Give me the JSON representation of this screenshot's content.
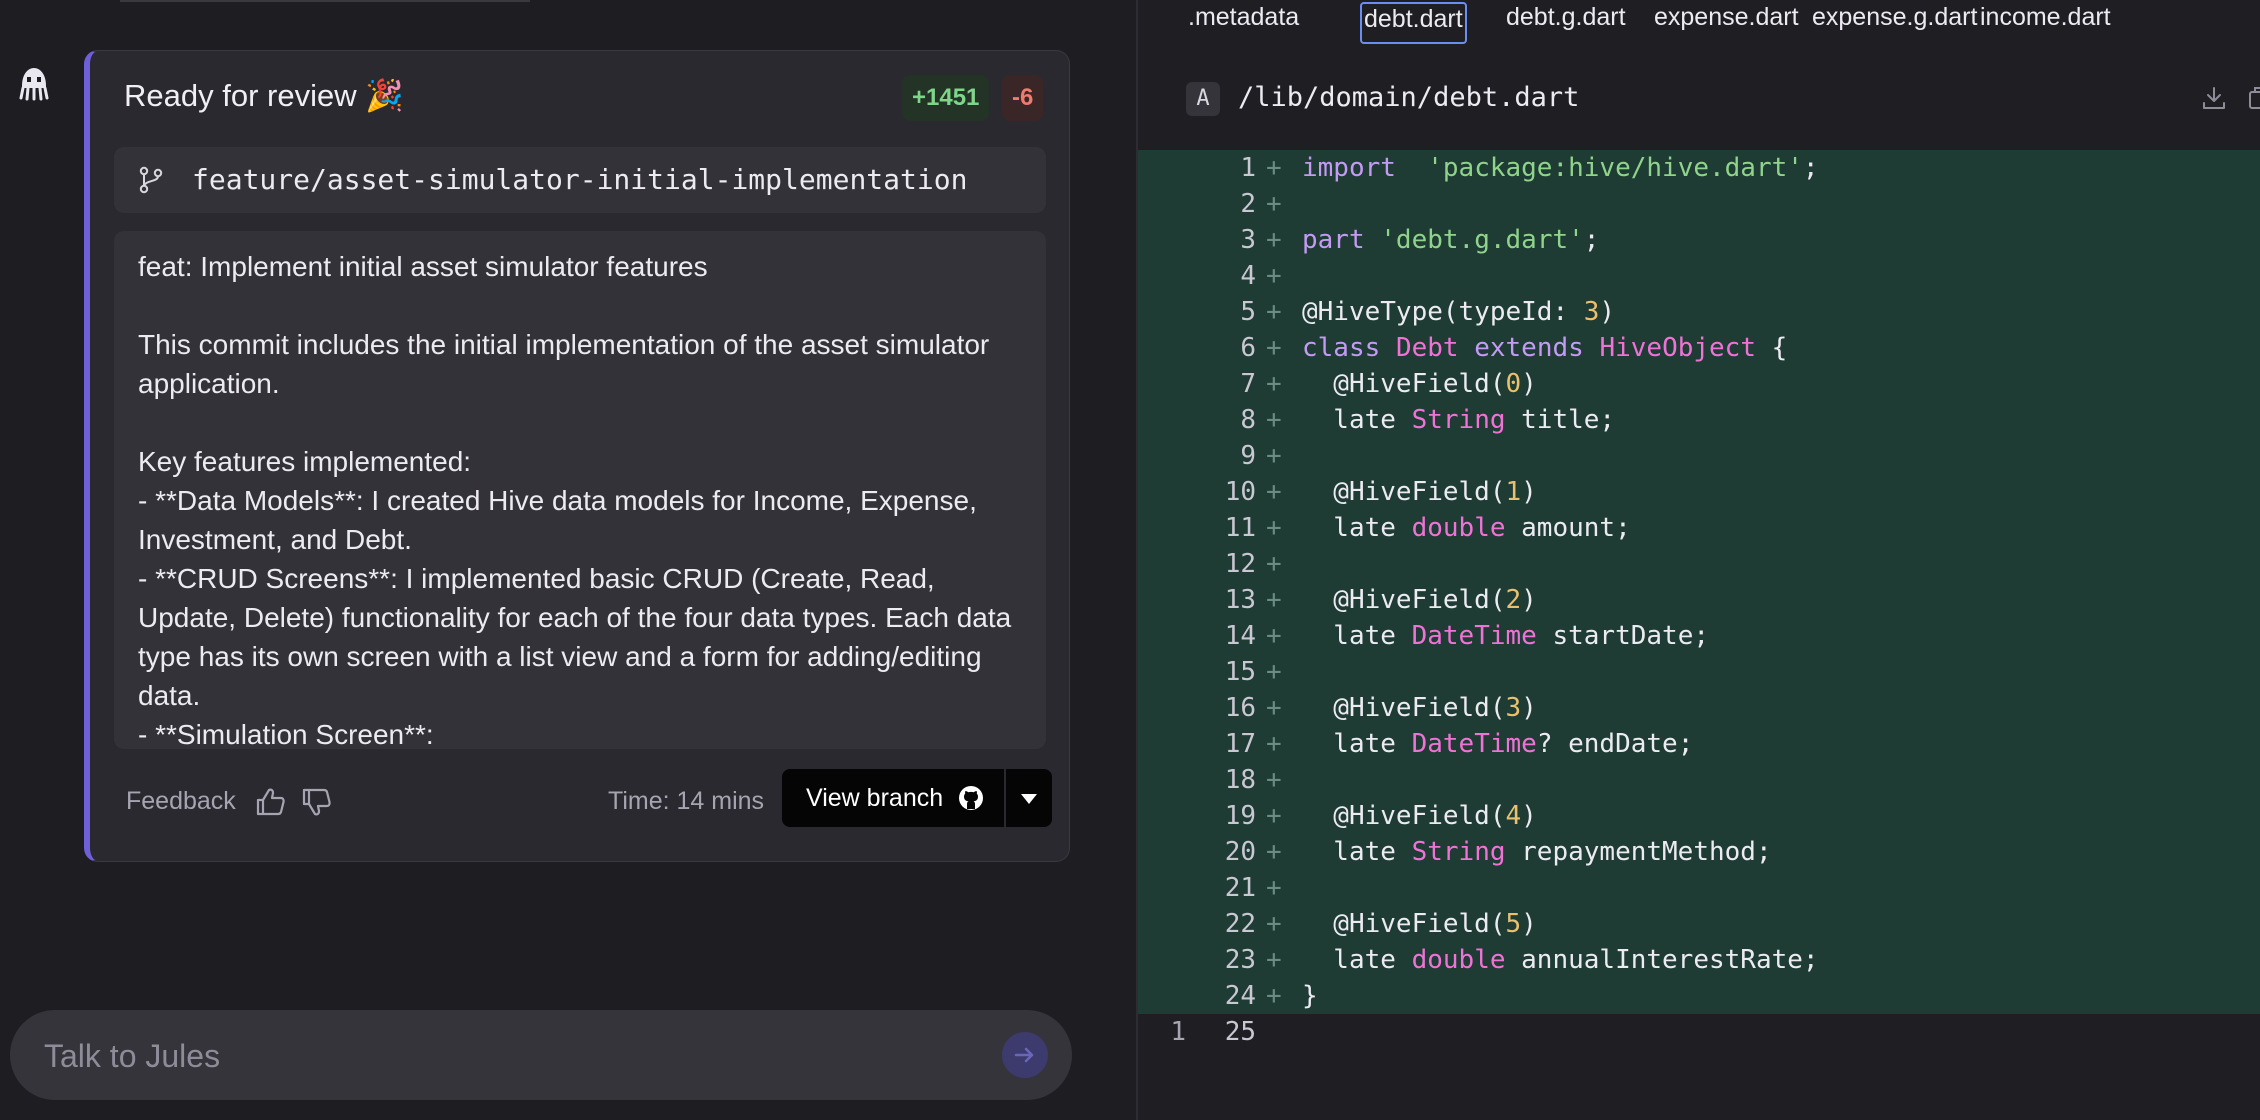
{
  "card": {
    "title": "Ready for review 🎉",
    "additions": "+1451",
    "deletions": "-6",
    "branch": "feature/asset-simulator-initial-implementation",
    "commit_lines": [
      "feat: Implement initial asset simulator features",
      "",
      "This commit includes the initial implementation of the asset simulator application.",
      "",
      "Key features implemented:",
      "-   **Data Models**: I created Hive data models for Income, Expense, Investment, and Debt.",
      "-   **CRUD Screens**: I implemented basic CRUD (Create, Read, Update, Delete) functionality for each of the four data types. Each data type has its own screen with a list view and a form for adding/editing data.",
      "-   **Simulation Screen**:"
    ],
    "feedback_label": "Feedback",
    "time_label": "Time: 14 mins",
    "view_branch_label": "View branch"
  },
  "chat": {
    "placeholder": "Talk to Jules"
  },
  "file_tabs": [
    {
      "label": ".metadata",
      "active": false
    },
    {
      "label": "debt.dart",
      "active": true
    },
    {
      "label": "debt.g.dart",
      "active": false
    },
    {
      "label": "expense.dart",
      "active": false
    },
    {
      "label": "expense.g.dart",
      "active": false
    },
    {
      "label": "income.dart",
      "active": false
    }
  ],
  "file": {
    "type_badge": "A",
    "path": "/lib/domain/debt.dart"
  },
  "code_lines": [
    {
      "old": "",
      "new": "1",
      "added": true,
      "tokens": [
        [
          "kw",
          "import"
        ],
        [
          "",
          "  "
        ],
        [
          "str",
          "'package:hive/hive.dart'"
        ],
        [
          "",
          ";"
        ]
      ]
    },
    {
      "old": "",
      "new": "2",
      "added": true,
      "tokens": []
    },
    {
      "old": "",
      "new": "3",
      "added": true,
      "tokens": [
        [
          "kw",
          "part"
        ],
        [
          "",
          " "
        ],
        [
          "str",
          "'debt.g.dart'"
        ],
        [
          "",
          ";"
        ]
      ]
    },
    {
      "old": "",
      "new": "4",
      "added": true,
      "tokens": []
    },
    {
      "old": "",
      "new": "5",
      "added": true,
      "tokens": [
        [
          "",
          "@HiveType(typeId: "
        ],
        [
          "num",
          "3"
        ],
        [
          "",
          ")"
        ]
      ]
    },
    {
      "old": "",
      "new": "6",
      "added": true,
      "tokens": [
        [
          "kw",
          "class"
        ],
        [
          "",
          " "
        ],
        [
          "type",
          "Debt"
        ],
        [
          "",
          " "
        ],
        [
          "kw",
          "extends"
        ],
        [
          "",
          " "
        ],
        [
          "type",
          "HiveObject"
        ],
        [
          "",
          " {"
        ]
      ]
    },
    {
      "old": "",
      "new": "7",
      "added": true,
      "tokens": [
        [
          "",
          "  @HiveField("
        ],
        [
          "num",
          "0"
        ],
        [
          "",
          ")"
        ]
      ]
    },
    {
      "old": "",
      "new": "8",
      "added": true,
      "tokens": [
        [
          "",
          "  late "
        ],
        [
          "type",
          "String"
        ],
        [
          "",
          " title;"
        ]
      ]
    },
    {
      "old": "",
      "new": "9",
      "added": true,
      "tokens": []
    },
    {
      "old": "",
      "new": "10",
      "added": true,
      "tokens": [
        [
          "",
          "  @HiveField("
        ],
        [
          "num",
          "1"
        ],
        [
          "",
          ")"
        ]
      ]
    },
    {
      "old": "",
      "new": "11",
      "added": true,
      "tokens": [
        [
          "",
          "  late "
        ],
        [
          "type",
          "double"
        ],
        [
          "",
          " amount;"
        ]
      ]
    },
    {
      "old": "",
      "new": "12",
      "added": true,
      "tokens": []
    },
    {
      "old": "",
      "new": "13",
      "added": true,
      "tokens": [
        [
          "",
          "  @HiveField("
        ],
        [
          "num",
          "2"
        ],
        [
          "",
          ")"
        ]
      ]
    },
    {
      "old": "",
      "new": "14",
      "added": true,
      "tokens": [
        [
          "",
          "  late "
        ],
        [
          "type",
          "DateTime"
        ],
        [
          "",
          " startDate;"
        ]
      ]
    },
    {
      "old": "",
      "new": "15",
      "added": true,
      "tokens": []
    },
    {
      "old": "",
      "new": "16",
      "added": true,
      "tokens": [
        [
          "",
          "  @HiveField("
        ],
        [
          "num",
          "3"
        ],
        [
          "",
          ")"
        ]
      ]
    },
    {
      "old": "",
      "new": "17",
      "added": true,
      "tokens": [
        [
          "",
          "  late "
        ],
        [
          "type",
          "DateTime"
        ],
        [
          "",
          "? endDate;"
        ]
      ]
    },
    {
      "old": "",
      "new": "18",
      "added": true,
      "tokens": []
    },
    {
      "old": "",
      "new": "19",
      "added": true,
      "tokens": [
        [
          "",
          "  @HiveField("
        ],
        [
          "num",
          "4"
        ],
        [
          "",
          ")"
        ]
      ]
    },
    {
      "old": "",
      "new": "20",
      "added": true,
      "tokens": [
        [
          "",
          "  late "
        ],
        [
          "type",
          "String"
        ],
        [
          "",
          " repaymentMethod;"
        ]
      ]
    },
    {
      "old": "",
      "new": "21",
      "added": true,
      "tokens": []
    },
    {
      "old": "",
      "new": "22",
      "added": true,
      "tokens": [
        [
          "",
          "  @HiveField("
        ],
        [
          "num",
          "5"
        ],
        [
          "",
          ")"
        ]
      ]
    },
    {
      "old": "",
      "new": "23",
      "added": true,
      "tokens": [
        [
          "",
          "  late "
        ],
        [
          "type",
          "double"
        ],
        [
          "",
          " annualInterestRate;"
        ]
      ]
    },
    {
      "old": "",
      "new": "24",
      "added": true,
      "tokens": [
        [
          "",
          "}"
        ]
      ]
    },
    {
      "old": "1",
      "new": "25",
      "added": false,
      "tokens": []
    }
  ],
  "colors": {
    "accent": "#6f5fd8",
    "added_bg": "#1e3b34",
    "additions": "#7fd68a",
    "deletions": "#ef7a6e"
  }
}
